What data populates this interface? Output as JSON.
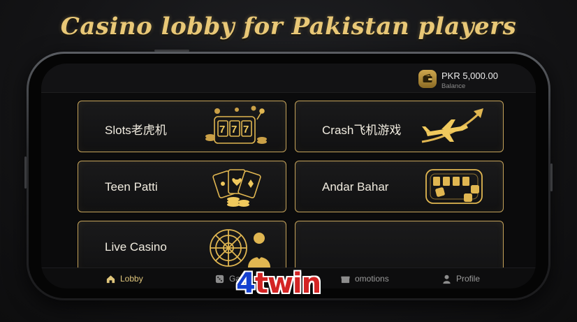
{
  "hero": {
    "title": "Casino lobby for Pakistan players"
  },
  "header": {
    "balance_amount": "PKR 5,000.00",
    "balance_label": "Balance"
  },
  "games": [
    {
      "label": "Slots老虎机",
      "icon": "slot-machine-icon"
    },
    {
      "label": "Crash飞机游戏",
      "icon": "airplane-icon"
    },
    {
      "label": "Teen Patti",
      "icon": "playing-cards-icon"
    },
    {
      "label": "Andar Bahar",
      "icon": "card-table-icon"
    },
    {
      "label": "Live Casino",
      "icon": "roulette-dealer-icon"
    }
  ],
  "tabs": [
    {
      "label": "Lobby",
      "icon": "home-icon",
      "active": true
    },
    {
      "label": "Ga",
      "icon": "dice-icon",
      "active": false
    },
    {
      "label": "omotions",
      "icon": "gift-icon",
      "active": false
    },
    {
      "label": "Profile",
      "icon": "user-icon",
      "active": false
    }
  ],
  "watermark": {
    "number": "4",
    "text": "twin"
  },
  "colors": {
    "accent_gold": "#c4a25a",
    "title_gold": "#e9c877",
    "brand_red": "#d32424",
    "brand_blue": "#1440d0"
  }
}
